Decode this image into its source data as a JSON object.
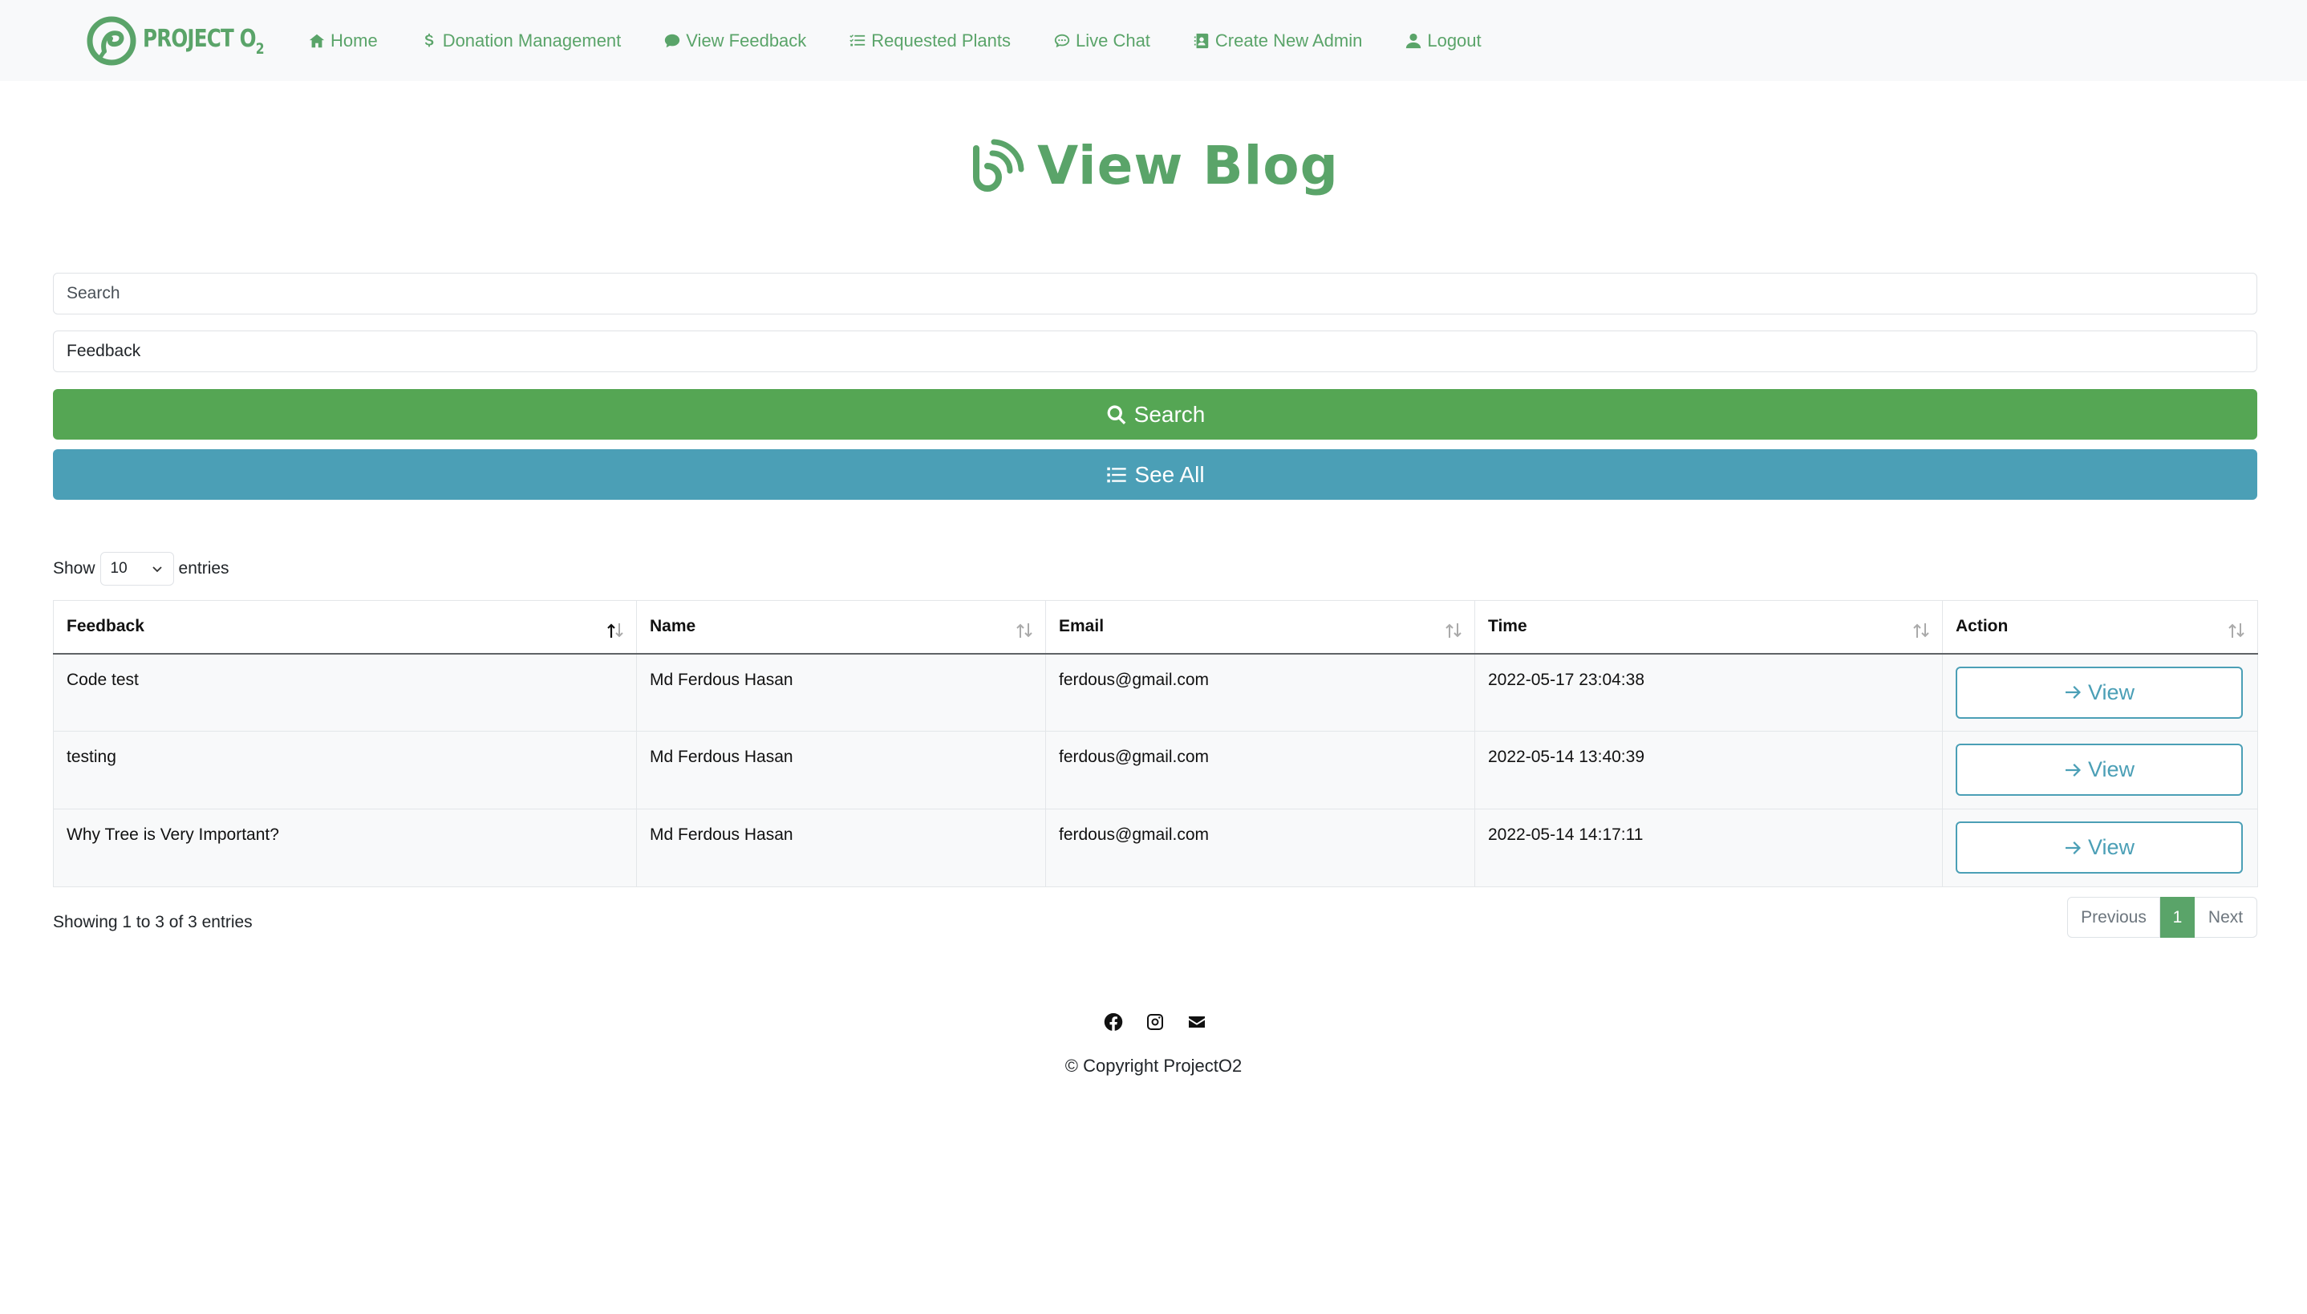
{
  "brand": {
    "name": "PROJECT O",
    "sub": "2"
  },
  "nav": {
    "home": "Home",
    "donation": "Donation Management",
    "feedback": "View Feedback",
    "plants": "Requested Plants",
    "chat": "Live Chat",
    "admin": "Create New Admin",
    "logout": "Logout"
  },
  "page": {
    "title": "View Blog"
  },
  "form": {
    "search_placeholder": "Search",
    "feedback_value": "Feedback",
    "search_button": "Search",
    "see_all_button": "See All"
  },
  "length": {
    "show": "Show",
    "value": "10",
    "entries": "entries"
  },
  "table": {
    "headers": [
      "Feedback",
      "Name",
      "Email",
      "Time",
      "Action"
    ],
    "rows": [
      {
        "feedback": "Code test",
        "name": "Md Ferdous Hasan",
        "email": "ferdous@gmail.com",
        "time": "2022-05-17 23:04:38",
        "action": "View"
      },
      {
        "feedback": "testing",
        "name": "Md Ferdous Hasan",
        "email": "ferdous@gmail.com",
        "time": "2022-05-14 13:40:39",
        "action": "View"
      },
      {
        "feedback": "Why Tree is Very Important?",
        "name": "Md Ferdous Hasan",
        "email": "ferdous@gmail.com",
        "time": "2022-05-14 14:17:11",
        "action": "View"
      }
    ],
    "info": "Showing 1 to 3 of 3 entries"
  },
  "pagination": {
    "previous": "Previous",
    "current": "1",
    "next": "Next"
  },
  "footer": {
    "icons": [
      "facebook-icon",
      "instagram-icon",
      "envelope-icon"
    ],
    "copyright": "© Copyright ProjectO2"
  },
  "colors": {
    "brand_green": "#5aa469",
    "search_green": "#55a654",
    "info_blue": "#4b9fb6"
  }
}
